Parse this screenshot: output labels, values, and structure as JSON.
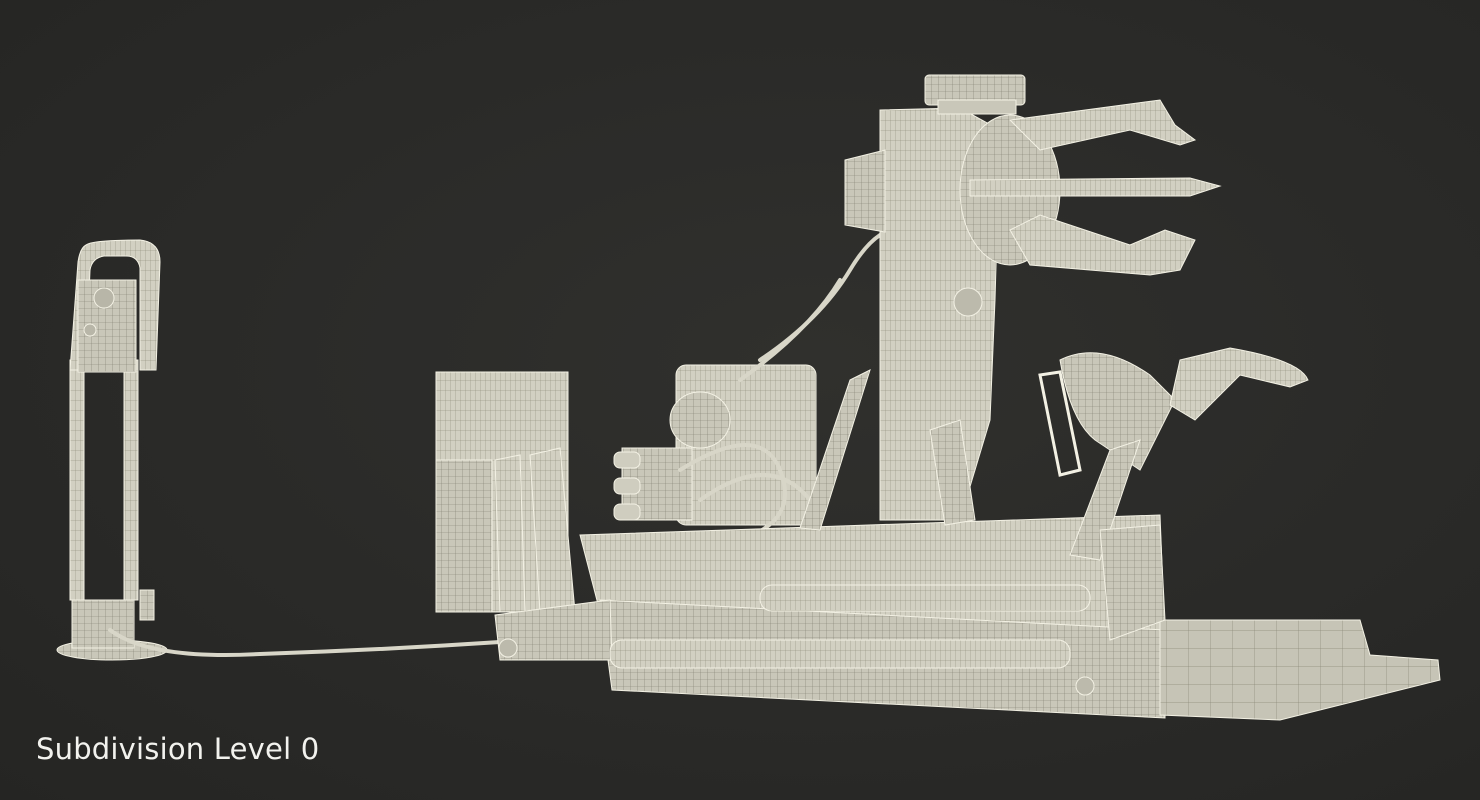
{
  "caption": "Subdivision Level 0",
  "colors": {
    "background": "#2a2a28",
    "wireframe_fill": "#cfcdbf",
    "wireframe_edge": "#f3f1e4",
    "caption_text": "#f2f2ee"
  },
  "subject": {
    "objects": [
      "control-pedestal",
      "hydraulic-cabinet",
      "power-unit",
      "robotic-arm-column",
      "gripper-claw",
      "secondary-arm",
      "base-platform",
      "floor-plate",
      "connecting-cable"
    ]
  }
}
